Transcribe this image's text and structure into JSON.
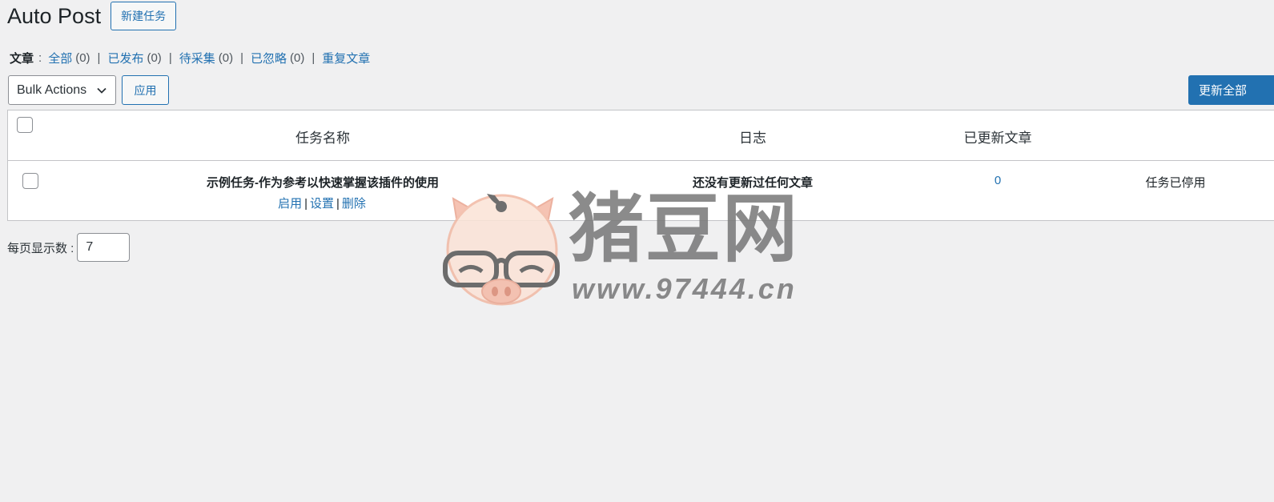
{
  "header": {
    "title": "Auto Post",
    "new_task_label": "新建任务"
  },
  "filters": {
    "label": "文章",
    "colon": ":",
    "items": [
      {
        "label": "全部",
        "count": "(0)"
      },
      {
        "label": "已发布",
        "count": "(0)"
      },
      {
        "label": "待采集",
        "count": "(0)"
      },
      {
        "label": "已忽略",
        "count": "(0)"
      },
      {
        "label": "重复文章"
      }
    ]
  },
  "toolbar": {
    "bulk_actions": "Bulk Actions",
    "apply_label": "应用",
    "update_all_label": "更新全部"
  },
  "table": {
    "columns": [
      "任务名称",
      "日志",
      "已更新文章"
    ],
    "rows": [
      {
        "name": "示例任务-作为参考以快速掌握该插件的使用",
        "actions": [
          "启用",
          "设置",
          "删除"
        ],
        "log": "还没有更新过任何文章",
        "updated_count": "0",
        "status": "任务已停用"
      }
    ]
  },
  "pagination": {
    "per_page_label": "每页显示数 :",
    "per_page_value": "7"
  },
  "watermark": {
    "text": "猪豆网",
    "url": "www.97444.cn"
  }
}
